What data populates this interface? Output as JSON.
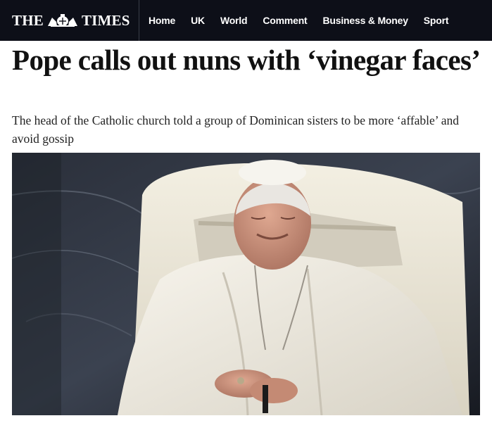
{
  "masthead": {
    "logo_left": "THE",
    "logo_right": "TIMES",
    "crest_icon": "royal-crest-icon"
  },
  "nav": {
    "items": [
      "Home",
      "UK",
      "World",
      "Comment",
      "Business & Money",
      "Sport"
    ]
  },
  "article": {
    "headline": "Pope calls out nuns with ‘vinegar faces’",
    "standfirst": "The head of the Catholic church told a group of Dominican sisters to be more ‘affable’ and avoid gossip"
  },
  "colors": {
    "topbar_bg": "#0d0f18",
    "text": "#111111"
  }
}
